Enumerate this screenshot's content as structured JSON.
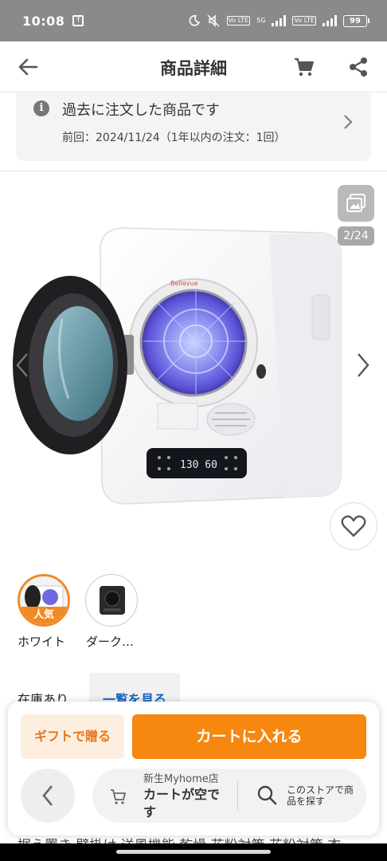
{
  "status": {
    "time": "10:08",
    "volte_a": "Vo LTE",
    "network": "5G",
    "volte_b": "Vo LTE",
    "battery": "99"
  },
  "header": {
    "title": "商品詳細"
  },
  "notice": {
    "title": "過去に注文した商品です",
    "subtitle": "前回：2024/11/24（1年以内の注文：1回）"
  },
  "gallery": {
    "counter": "2/24",
    "dryer_brand": "Bellevue",
    "dryer_display": "130 60"
  },
  "variants": [
    {
      "label": "ホワイト",
      "badge": "人気",
      "selected": true
    },
    {
      "label": "ダーク…",
      "selected": false
    }
  ],
  "stock": {
    "text": "在庫あり",
    "view_all": "一覧を見る"
  },
  "actions": {
    "gift": "ギフトで贈る",
    "add_to_cart": "カートに入れる"
  },
  "store": {
    "name": "新生Myhome店",
    "cart_status": "カートが空です",
    "search_label": "このストアで商品を探す"
  },
  "footer": {
    "text": "据え置き 壁掛け 送風機能 乾燥 花粉対策 花粉対策 衣"
  },
  "colors": {
    "accent": "#f6870f",
    "link": "#1565c0",
    "status_bg": "#8a8a8a"
  }
}
